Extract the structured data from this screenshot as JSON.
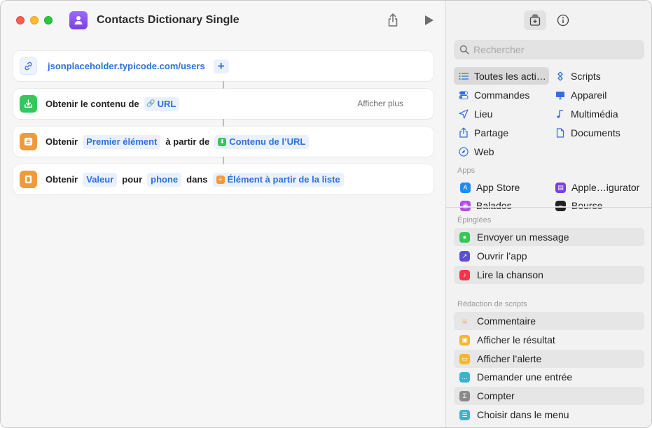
{
  "window": {
    "title": "Contacts Dictionary Single"
  },
  "actions": [
    {
      "type": "url",
      "url": "jsonplaceholder.typicode.com/users",
      "plus": "+"
    },
    {
      "label_before": "Obtenir le contenu de",
      "token": "URL",
      "show_more": "Afficher plus"
    },
    {
      "label_before": "Obtenir",
      "token1": "Premier élément",
      "label_mid": "à partir de",
      "token2": "Contenu de l’URL"
    },
    {
      "label_before": "Obtenir",
      "token1": "Valeur",
      "label_mid1": "pour",
      "token2": "phone",
      "label_mid2": "dans",
      "token3": "Élément à partir de la liste"
    }
  ],
  "sidebar": {
    "search_placeholder": "Rechercher",
    "categories": [
      {
        "label": "Toutes les acti…",
        "icon": "list-icon",
        "selected": true
      },
      {
        "label": "Scripts",
        "icon": "scripts-icon"
      },
      {
        "label": "Commandes",
        "icon": "toggle-icon"
      },
      {
        "label": "Appareil",
        "icon": "display-icon"
      },
      {
        "label": "Lieu",
        "icon": "location-arrow-icon"
      },
      {
        "label": "Multimédia",
        "icon": "music-note-icon"
      },
      {
        "label": "Partage",
        "icon": "share-icon"
      },
      {
        "label": "Documents",
        "icon": "document-icon"
      },
      {
        "label": "Web",
        "icon": "compass-icon"
      }
    ],
    "apps_label": "Apps",
    "apps": [
      {
        "label": "App Store",
        "color": "#1e8cf0"
      },
      {
        "label": "Apple…igurator",
        "color": "#7b3fe4"
      },
      {
        "label": "Balados",
        "color": "#b150e2"
      },
      {
        "label": "Bourse",
        "color": "#222222"
      }
    ],
    "pinned_label": "Épinglées",
    "pinned": [
      {
        "label": "Envoyer un message",
        "color": "#34c759",
        "icon": "message-icon"
      },
      {
        "label": "Ouvrir l’app",
        "color": "#5b4fd9",
        "icon": "open-app-icon"
      },
      {
        "label": "Lire la chanson",
        "color": "#f2364b",
        "icon": "music-icon"
      }
    ],
    "scripting_label": "Rédaction de scripts",
    "scripting": [
      {
        "label": "Commentaire",
        "color": "#f5d44a",
        "icon": "comment-lines-icon"
      },
      {
        "label": "Afficher le résultat",
        "color": "#f4b82a",
        "icon": "show-result-icon"
      },
      {
        "label": "Afficher l’alerte",
        "color": "#f4b82a",
        "icon": "alert-icon"
      },
      {
        "label": "Demander une entrée",
        "color": "#3ab4c9",
        "icon": "ask-input-icon"
      },
      {
        "label": "Compter",
        "color": "#8a8a8a",
        "icon": "sigma-icon"
      },
      {
        "label": "Choisir dans le menu",
        "color": "#3ab4c9",
        "icon": "menu-icon"
      }
    ]
  }
}
